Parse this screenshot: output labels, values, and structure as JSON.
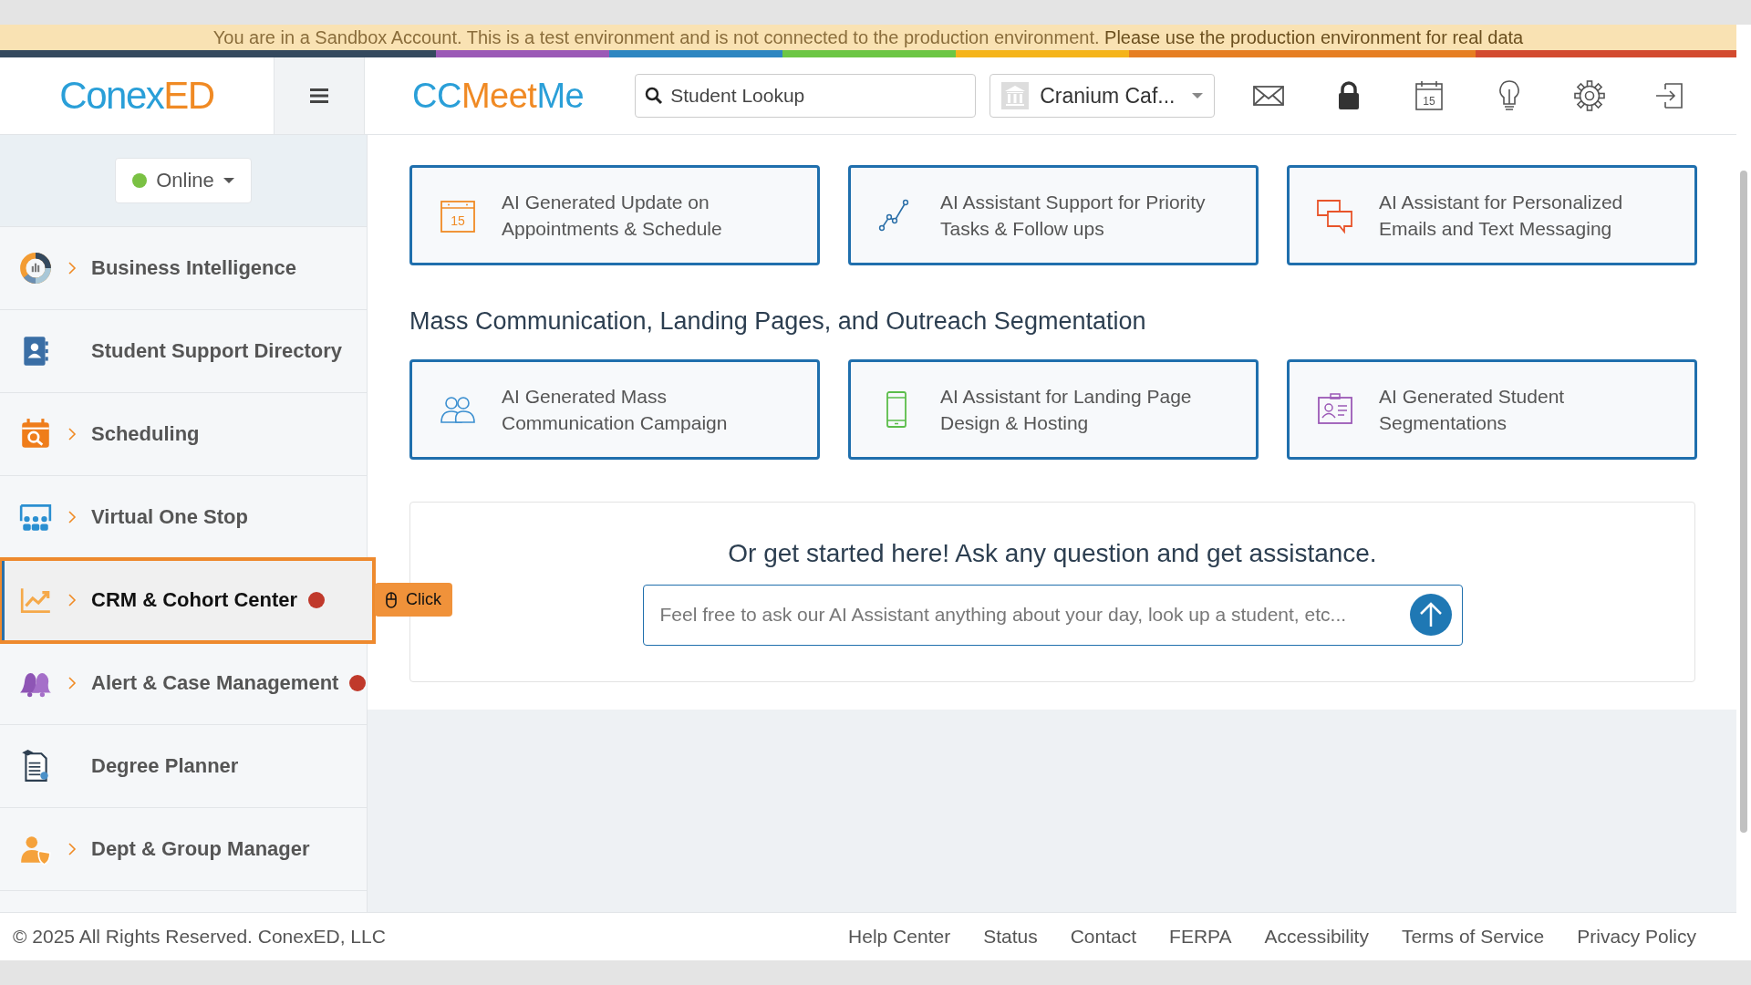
{
  "banner": {
    "text": "You are in a Sandbox Account. This is a test environment and is not connected to the production environment. ",
    "emphasis": "Please use the production environment for real data"
  },
  "header": {
    "logo": [
      {
        "text": "Conex",
        "kind": "primary"
      },
      {
        "text": "ED",
        "kind": "accent"
      }
    ],
    "app_logo": [
      {
        "text": "CC",
        "kind": "primary"
      },
      {
        "text": "Meet",
        "kind": "accent"
      },
      {
        "text": "Me",
        "kind": "primary"
      }
    ],
    "search": {
      "placeholder": "Student Lookup"
    },
    "location": {
      "value": "Cranium Caf..."
    },
    "calendar_day": "15"
  },
  "status": {
    "label": "Online",
    "color": "#7ac143"
  },
  "sidebar": {
    "items": [
      {
        "label": "Business Intelligence",
        "expandable": true,
        "alert": false,
        "selected": false
      },
      {
        "label": "Student Support Directory",
        "expandable": false,
        "alert": false,
        "selected": false
      },
      {
        "label": "Scheduling",
        "expandable": true,
        "alert": false,
        "selected": false
      },
      {
        "label": "Virtual One Stop",
        "expandable": true,
        "alert": false,
        "selected": false
      },
      {
        "label": "CRM & Cohort Center",
        "expandable": true,
        "alert": true,
        "selected": true
      },
      {
        "label": "Alert & Case Management",
        "expandable": true,
        "alert": true,
        "selected": false
      },
      {
        "label": "Degree Planner",
        "expandable": false,
        "alert": false,
        "selected": false
      },
      {
        "label": "Dept & Group Manager",
        "expandable": true,
        "alert": false,
        "selected": false
      }
    ]
  },
  "click_hint": {
    "label": "Click"
  },
  "sections": [
    {
      "cards": [
        {
          "label": "AI Generated Update on Appointments & Schedule",
          "day": "15"
        },
        {
          "label": "AI Assistant Support for Priority Tasks & Follow ups"
        },
        {
          "label": "AI Assistant for Personalized Emails and Text Messaging"
        }
      ]
    },
    {
      "heading": "Mass Communication, Landing Pages, and Outreach Segmentation",
      "cards": [
        {
          "label": "AI Generated Mass Communication Campaign"
        },
        {
          "label": "AI Assistant for Landing Page Design & Hosting"
        },
        {
          "label": "AI Generated Student Segmentations"
        }
      ]
    }
  ],
  "assistant": {
    "heading": "Or get started here! Ask any question and get assistance.",
    "placeholder": "Feel free to ask our AI Assistant anything about your day, look up a student, etc..."
  },
  "footer": {
    "copyright": "© 2025 All Rights Reserved. ConexED, LLC",
    "links": [
      "Help Center",
      "Status",
      "Contact",
      "FERPA",
      "Accessibility",
      "Terms of Service",
      "Privacy Policy"
    ]
  }
}
